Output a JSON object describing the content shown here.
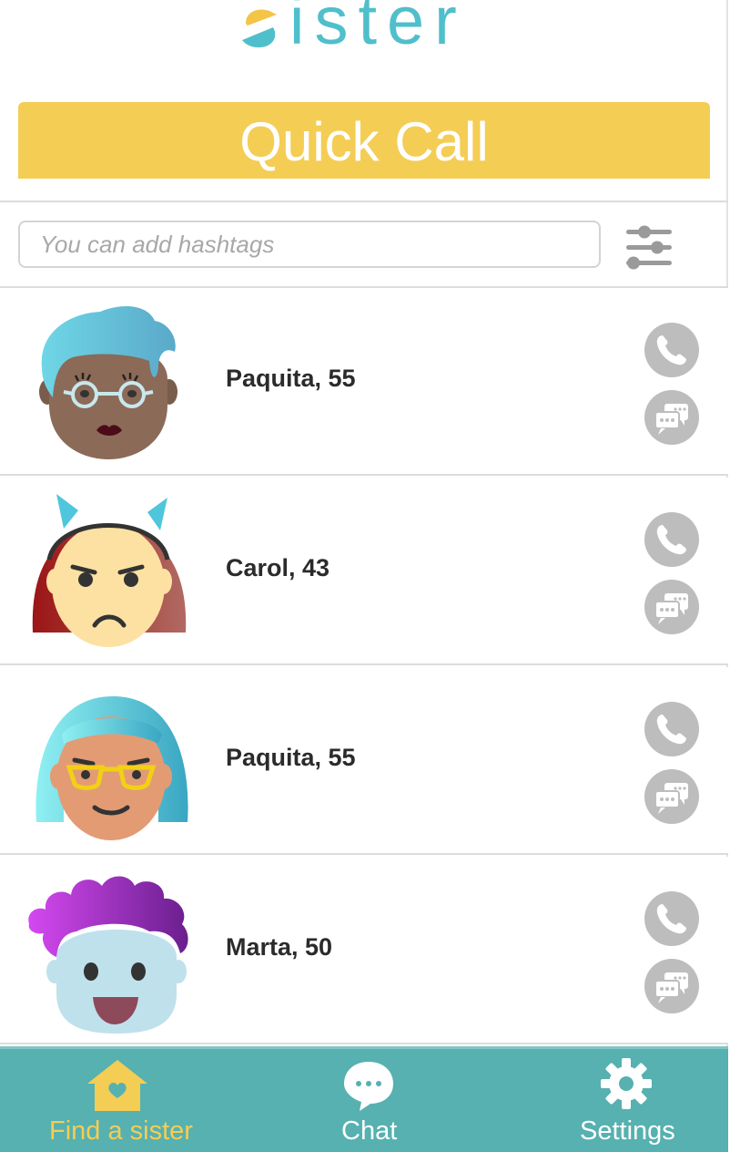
{
  "app": {
    "logo_text": "ister",
    "logo_icon": "s-logo-mark"
  },
  "quick_call": {
    "label": "Quick Call"
  },
  "search": {
    "placeholder": "You can add hashtags",
    "value": "",
    "filter_icon": "sliders-icon"
  },
  "contacts": [
    {
      "name": "Paquita, 55",
      "avatar": "avatar-blue-hair-dark-skin"
    },
    {
      "name": "Carol, 43",
      "avatar": "avatar-red-hair-cat-ears"
    },
    {
      "name": "Paquita, 55",
      "avatar": "avatar-teal-hair-glasses"
    },
    {
      "name": "Marta, 50",
      "avatar": "avatar-purple-hair"
    }
  ],
  "row_actions": {
    "call_icon": "phone-icon",
    "message_icon": "chat-bubbles-icon"
  },
  "nav": {
    "items": [
      {
        "label": "Find a sister",
        "icon": "home-heart-icon",
        "active": true
      },
      {
        "label": "Chat",
        "icon": "chat-bubble-icon",
        "active": false
      },
      {
        "label": "Settings",
        "icon": "gear-icon",
        "active": false
      }
    ]
  },
  "colors": {
    "accent_yellow": "#f4cd55",
    "brand_teal": "#4fbfcb",
    "nav_background": "#56b1b0",
    "action_button_gray": "#bdbdbd"
  }
}
